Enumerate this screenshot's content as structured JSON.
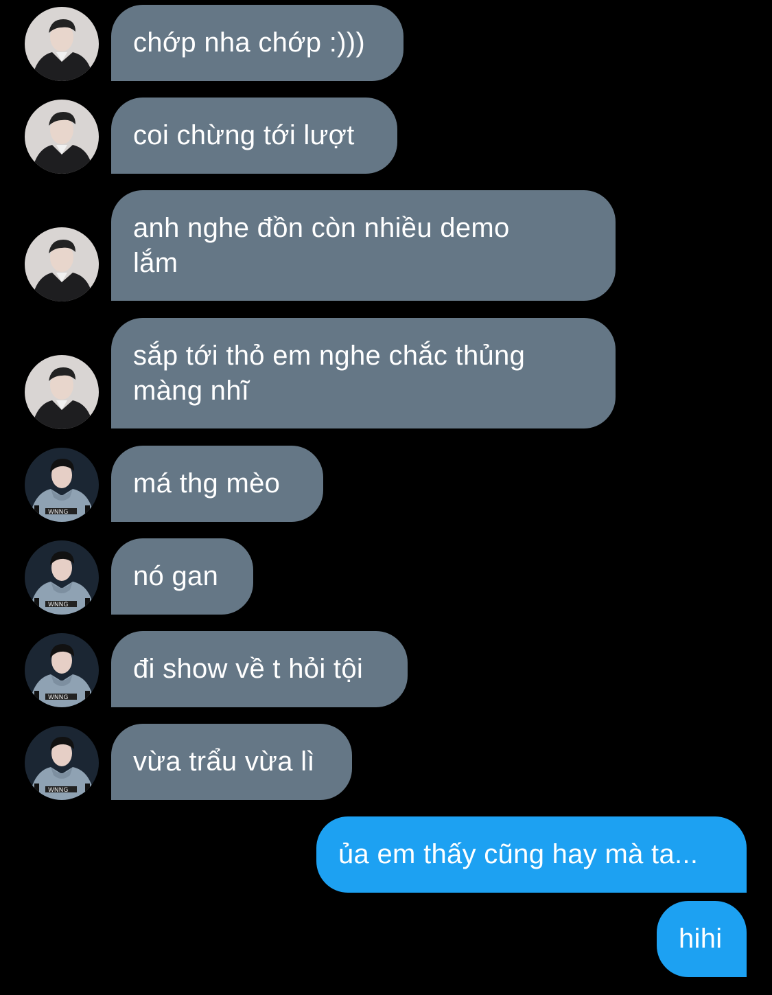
{
  "colors": {
    "background": "#000000",
    "incoming_bubble": "#657786",
    "outgoing_bubble": "#1da1f2",
    "text": "#ffffff"
  },
  "contacts": {
    "a": {
      "avatar_icon": "profile-photo-man-dark-jacket"
    },
    "b": {
      "avatar_icon": "profile-photo-man-grey-hoodie"
    }
  },
  "messages": [
    {
      "from": "a",
      "direction": "incoming",
      "text": "chớp nha chớp :)))"
    },
    {
      "from": "a",
      "direction": "incoming",
      "text": "coi chừng tới lượt"
    },
    {
      "from": "a",
      "direction": "incoming",
      "text": "anh nghe đồn còn nhiều demo\nlắm"
    },
    {
      "from": "a",
      "direction": "incoming",
      "text": "sắp tới thỏ em nghe chắc thủng\nmàng nhĩ"
    },
    {
      "from": "b",
      "direction": "incoming",
      "text": "má thg mèo"
    },
    {
      "from": "b",
      "direction": "incoming",
      "text": "nó gan"
    },
    {
      "from": "b",
      "direction": "incoming",
      "text": "đi show về t hỏi tội"
    },
    {
      "from": "b",
      "direction": "incoming",
      "text": "vừa trẩu vừa lì"
    },
    {
      "from": "me",
      "direction": "outgoing",
      "text": "ủa em thấy cũng hay mà ta..."
    },
    {
      "from": "me",
      "direction": "outgoing",
      "text": "hihi"
    }
  ]
}
